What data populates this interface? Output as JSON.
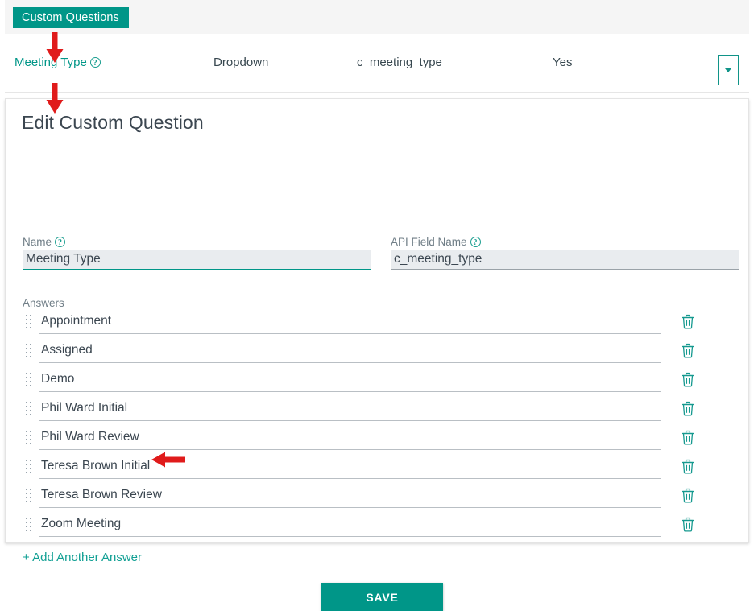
{
  "tabs": {
    "items": [
      {
        "label": "Custom Questions",
        "active": true
      }
    ]
  },
  "questions_table": {
    "row": {
      "name": "Meeting Type",
      "type": "Dropdown",
      "api_field_name": "c_meeting_type",
      "required": "Yes",
      "menu_icon": "chevron-down-icon"
    }
  },
  "edit_panel": {
    "title": "Edit Custom Question",
    "name_field": {
      "label": "Name",
      "value": "Meeting Type",
      "placeholder": "",
      "help_icon": "question-mark-circle-icon",
      "focused": true
    },
    "api_field": {
      "label": "API Field Name",
      "value": "c_meeting_type",
      "placeholder": "",
      "help_icon": "question-mark-circle-icon",
      "focused": false
    },
    "answers_label": "Answers",
    "answers": [
      {
        "value": "Appointment"
      },
      {
        "value": "Assigned"
      },
      {
        "value": "Demo"
      },
      {
        "value": "Phil Ward Initial"
      },
      {
        "value": "Phil Ward Review"
      },
      {
        "value": "Teresa Brown Initial"
      },
      {
        "value": "Teresa Brown Review"
      },
      {
        "value": "Zoom Meeting"
      }
    ],
    "answer_row_icons": {
      "drag": "drag-handle-dots-icon",
      "delete": "trash-icon"
    },
    "add_answer_label": "+ Add Another Answer",
    "save_label": "SAVE"
  },
  "annotations": [
    {
      "name": "arrow-pointing-to-meeting-type-link",
      "direction": "down",
      "color": "#e01b1b"
    },
    {
      "name": "arrow-pointing-to-edit-panel",
      "direction": "down",
      "color": "#e01b1b"
    },
    {
      "name": "arrow-pointing-to-add-another-answer",
      "direction": "left",
      "color": "#e01b1b"
    }
  ],
  "colors": {
    "brand_teal": "#009688",
    "link_teal": "#12a094",
    "annotation_red": "#e01b1b",
    "field_bg": "#e9ecef",
    "text_dark": "#3b4650",
    "label_gray": "#6f7d86"
  }
}
